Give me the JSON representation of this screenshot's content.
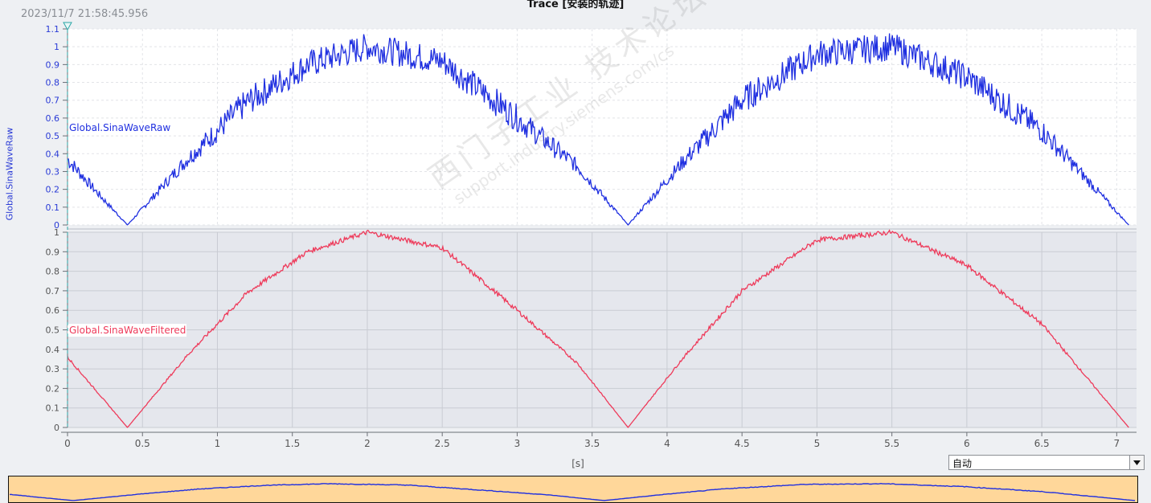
{
  "title": "Trace [安装的轨迹]",
  "timestamp": "2023/11/7 21:58:45.956",
  "zoom_select": {
    "value": "自动"
  },
  "watermark": {
    "line1": "西门子工业 技术论坛",
    "line2": "support.industry.siemens.com/cs"
  },
  "colors": {
    "raw": "#1f2fe0",
    "filtered": "#ee3a5a",
    "plot_top_bg": "#ffffff",
    "plot_bottom_bg": "#e5e7ed",
    "overview_bg": "#ffd79a",
    "cursor": "#2aa6a6"
  },
  "chart_data": {
    "type": "line",
    "xlabel": "[s]",
    "xlim": [
      0,
      7.1
    ],
    "x_ticks": [
      "0",
      "0.5",
      "1",
      "1.5",
      "2",
      "2.5",
      "3",
      "3.5",
      "4",
      "4.5",
      "5",
      "5.5",
      "6",
      "6.5",
      "7"
    ],
    "panels": [
      {
        "name": "raw",
        "ylabel": "Global.SinaWaveRaw",
        "series_label": "Global.SinaWaveRaw",
        "ylim": [
          0,
          1.1
        ],
        "y_ticks": [
          "0",
          "0.1",
          "0.2",
          "0.3",
          "0.4",
          "0.5",
          "0.6",
          "0.7",
          "0.8",
          "0.9",
          "1",
          "1.1"
        ],
        "shape": "abs-sine with noise",
        "x": [
          0,
          0.2,
          0.4,
          0.8,
          1.2,
          1.6,
          2.0,
          2.5,
          3.0,
          3.4,
          3.74,
          4.1,
          4.5,
          5.0,
          5.5,
          6.0,
          6.5,
          7.08
        ],
        "y": [
          0.37,
          0.18,
          0.0,
          0.37,
          0.69,
          0.9,
          1.0,
          0.92,
          0.6,
          0.33,
          0.0,
          0.35,
          0.7,
          0.96,
          1.0,
          0.83,
          0.53,
          0.0
        ]
      },
      {
        "name": "filtered",
        "ylabel": "",
        "series_label": "Global.SinaWaveFiltered",
        "ylim": [
          0,
          1
        ],
        "y_ticks": [
          "0",
          "0.1",
          "0.2",
          "0.3",
          "0.4",
          "0.5",
          "0.6",
          "0.7",
          "0.8",
          "0.9",
          "1"
        ],
        "shape": "abs-sine filtered",
        "x": [
          0,
          0.2,
          0.4,
          0.8,
          1.2,
          1.6,
          2.0,
          2.5,
          3.0,
          3.4,
          3.74,
          4.1,
          4.5,
          5.0,
          5.5,
          6.0,
          6.5,
          7.08
        ],
        "y": [
          0.36,
          0.18,
          0.0,
          0.37,
          0.69,
          0.9,
          1.0,
          0.92,
          0.6,
          0.33,
          0.0,
          0.35,
          0.7,
          0.96,
          1.0,
          0.83,
          0.53,
          0.0
        ]
      }
    ]
  }
}
